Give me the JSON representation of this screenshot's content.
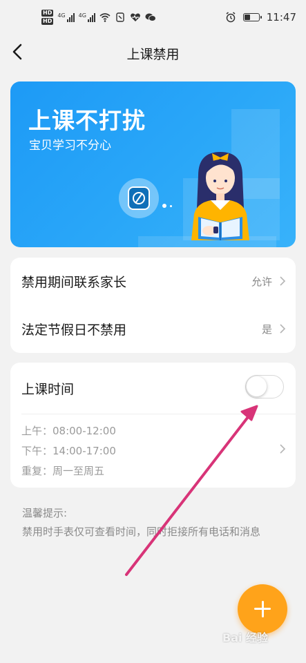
{
  "status_bar": {
    "hd_top": "HD",
    "hd_bottom": "HD",
    "signal1": "4G",
    "signal2": "4G",
    "time": "11:47",
    "icons": [
      "wifi-icon",
      "sim-icon",
      "heart-rate-icon",
      "wechat-icon",
      "alarm-icon",
      "battery-icon"
    ]
  },
  "nav": {
    "title": "上课禁用"
  },
  "banner": {
    "title": "上课不打扰",
    "subtitle": "宝贝学习不分心"
  },
  "settings": [
    {
      "label": "禁用期间联系家长",
      "value": "允许"
    },
    {
      "label": "法定节假日不禁用",
      "value": "是"
    }
  ],
  "class_time": {
    "title": "上课时间",
    "enabled": false,
    "morning": "上午：08:00-12:00",
    "afternoon": "下午：14:00-17:00",
    "repeat": "重复：周一至周五"
  },
  "tips": {
    "title": "温馨提示:",
    "body": "禁用时手表仅可查看时间，同时拒接所有电话和消息"
  },
  "fab": {
    "icon": "plus-icon"
  },
  "watermark": "Bai 经验",
  "colors": {
    "banner": "#2aa7f8",
    "fab": "#ffa31a",
    "arrow": "#d83478"
  }
}
